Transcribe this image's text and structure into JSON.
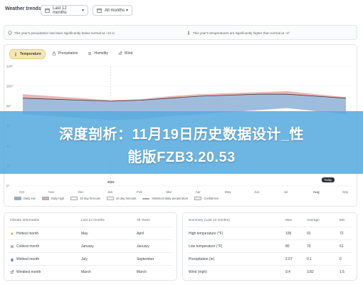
{
  "app": {
    "title": "Weather trends"
  },
  "filters": {
    "range_label": "Last 12 months",
    "years_label": "All months"
  },
  "notes": {
    "precip": "This year's precipitation has been significantly below normal at ~12 in",
    "temp": "This year's temperatures are significantly higher than normal at ~3°"
  },
  "tabs": [
    {
      "label": "Temperature",
      "icon": "thermometer-icon"
    },
    {
      "label": "Precipitation",
      "icon": "droplet-icon"
    },
    {
      "label": "Humidity",
      "icon": "humidity-icon"
    },
    {
      "label": "Wind",
      "icon": "wind-icon"
    }
  ],
  "chart": {
    "y_ticks": [
      "120°",
      "100°",
      "80°",
      "60°",
      "40°",
      "20°",
      "0°"
    ],
    "x_ticks": [
      "Oct",
      "Nov",
      "Dec",
      "Jan",
      "Feb",
      "Mar",
      "Apr",
      "May",
      "Jun",
      "Jul",
      "Aug",
      "Sep"
    ],
    "year_marker": "2024",
    "today_label": "Today",
    "legend": [
      "Daily low",
      "Daily high",
      "30 day forecast",
      "10 day forecast",
      "Historical daily temperature",
      "Confidence"
    ]
  },
  "chart_data": {
    "type": "area",
    "y_range": [
      0,
      120
    ],
    "x": [
      "Oct",
      "Nov",
      "Dec",
      "Jan",
      "Feb",
      "Mar",
      "Apr",
      "May",
      "Jun",
      "Jul",
      "Aug",
      "Sep"
    ],
    "series": [
      {
        "name": "Daily high",
        "values": [
          92,
          90,
          88,
          86,
          87,
          90,
          92,
          93,
          94,
          95,
          92,
          89
        ]
      },
      {
        "name": "Daily low",
        "values": [
          72,
          70,
          68,
          66,
          67,
          70,
          72,
          74,
          76,
          78,
          75,
          72
        ]
      },
      {
        "name": "Historical daily temperature",
        "values": [
          88,
          87,
          86,
          85,
          86,
          88,
          90,
          91,
          92,
          92,
          90,
          88
        ]
      }
    ]
  },
  "banner": {
    "line1": "深度剖析：11月19日历史数据设计_性",
    "line2": "能版FZB3.20.53"
  },
  "climate": {
    "headers": [
      "Climate information",
      "Last 12 months",
      "All Years"
    ],
    "rows": [
      {
        "label": "Hottest month",
        "a": "May",
        "b": "April",
        "icon": "sun-icon"
      },
      {
        "label": "Coldest month",
        "a": "January",
        "b": "January",
        "icon": "snowflake-icon"
      },
      {
        "label": "Wettest month",
        "a": "July",
        "b": "September",
        "icon": "droplet-icon"
      },
      {
        "label": "Windiest month",
        "a": "March",
        "b": "March",
        "icon": "wind-icon"
      }
    ]
  },
  "summary": {
    "headers": [
      "Summary (Last 12 months)",
      "Max",
      "Average",
      "Min"
    ],
    "rows": [
      {
        "label": "High temperature (°F)",
        "max": "106",
        "avg": "91",
        "min": "72",
        "icon": "thermometer-icon"
      },
      {
        "label": "Low temperature (°F)",
        "max": "80",
        "avg": "70",
        "min": "51",
        "icon": "thermometer-icon"
      },
      {
        "label": "Precipitation (in)",
        "max": "2.07",
        "avg": "0.1",
        "min": "0",
        "icon": "droplet-icon"
      },
      {
        "label": "Wind (mph)",
        "max": "9.4",
        "avg": "3.82",
        "min": "1.5",
        "icon": "wind-icon"
      }
    ]
  },
  "colors": {
    "high_band": "#e9a7a7",
    "low_band": "#8fb0d6",
    "accent": "#f5e7b5",
    "banner": "#55aade"
  }
}
